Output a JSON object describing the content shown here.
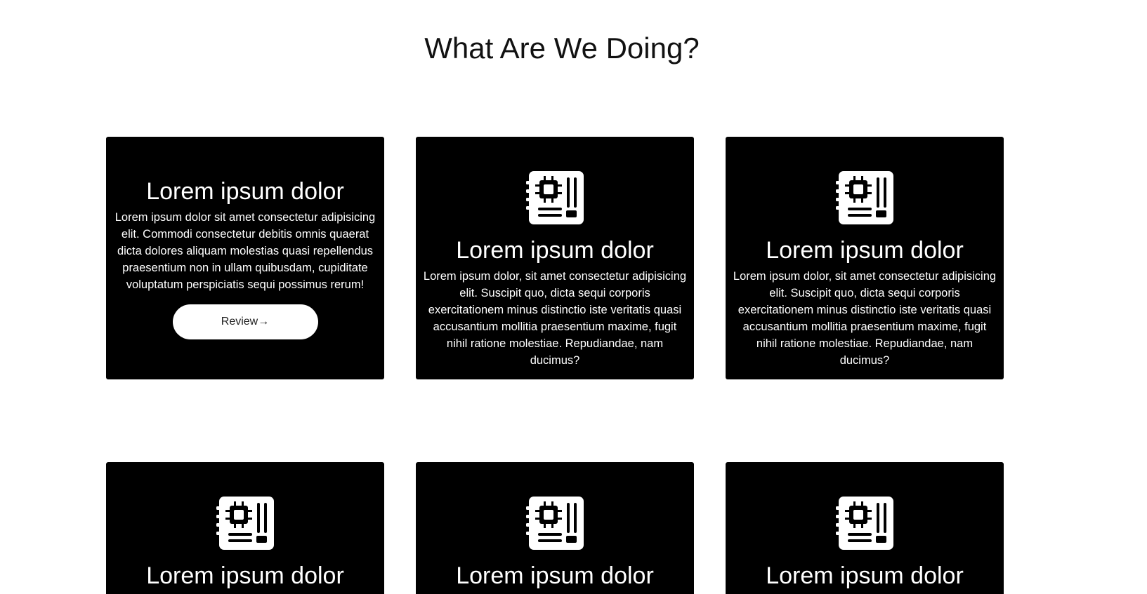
{
  "section": {
    "title": "What Are We Doing?"
  },
  "cards": [
    {
      "title": "Lorem ipsum dolor",
      "text": "Lorem ipsum dolor sit amet consectetur adipisicing elit. Commodi consectetur debitis omnis quaerat dicta dolores aliquam molestias quasi repellendus praesentium non in ullam quibusdam, cupiditate voluptatum perspiciatis sequi possimus rerum!",
      "button_label": "Review→"
    },
    {
      "icon": "circuit-board-icon",
      "title": "Lorem ipsum dolor",
      "text": "Lorem ipsum dolor, sit amet consectetur adipisicing elit. Suscipit quo, dicta sequi corporis exercitationem minus distinctio iste veritatis quasi accusantium mollitia praesentium maxime, fugit nihil ratione molestiae. Repudiandae, nam ducimus?"
    },
    {
      "icon": "circuit-board-icon",
      "title": "Lorem ipsum dolor",
      "text": "Lorem ipsum dolor, sit amet consectetur adipisicing elit. Suscipit quo, dicta sequi corporis exercitationem minus distinctio iste veritatis quasi accusantium mollitia praesentium maxime, fugit nihil ratione molestiae. Repudiandae, nam ducimus?"
    },
    {
      "icon": "circuit-board-icon",
      "title": "Lorem ipsum dolor"
    },
    {
      "icon": "circuit-board-icon",
      "title": "Lorem ipsum dolor"
    },
    {
      "icon": "circuit-board-icon",
      "title": "Lorem ipsum dolor"
    }
  ],
  "colors": {
    "card_background": "#000000",
    "card_text": "#ffffff",
    "page_background": "#ffffff",
    "button_background": "#ffffff"
  }
}
